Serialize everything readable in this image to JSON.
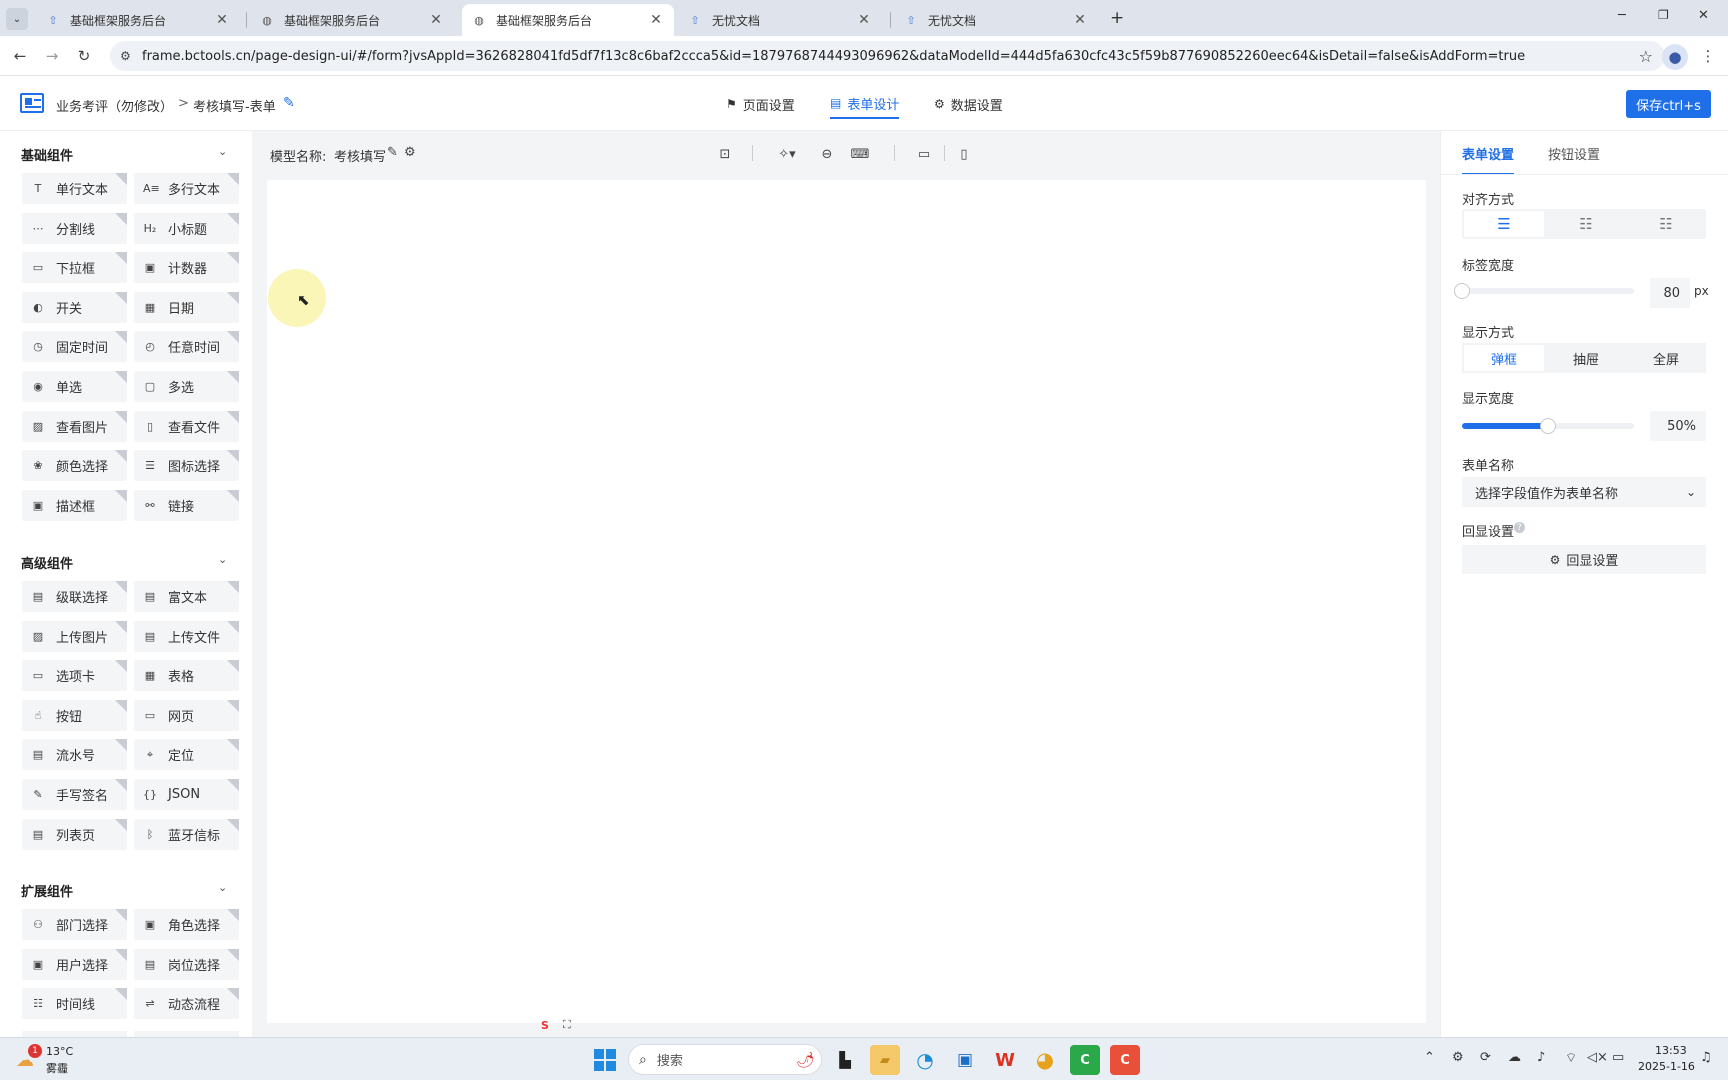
{
  "browser": {
    "tabs": [
      {
        "title": "基础框架服务后台",
        "active": false
      },
      {
        "title": "基础框架服务后台",
        "active": false
      },
      {
        "title": "基础框架服务后台",
        "active": true
      },
      {
        "title": "无忧文档",
        "active": false
      },
      {
        "title": "无忧文档",
        "active": false
      }
    ],
    "url": "frame.bctools.cn/page-design-ui/#/form?jvsAppId=3626828041fd5df7f13c8c6baf2ccca5&id=1879768744493096962&dataModelId=444d5fa630cfc43c5f59b877690852260eec64&isDetail=false&isAddForm=true"
  },
  "header": {
    "crumb_root": "业务考评（勿修改）",
    "crumb_sep": ">",
    "crumb_current": "考核填写-表单",
    "nav_tabs": [
      {
        "label": "页面设置",
        "icon": "bookmark-icon"
      },
      {
        "label": "表单设计",
        "icon": "form-icon"
      },
      {
        "label": "数据设置",
        "icon": "gear-icon"
      }
    ],
    "save_label": "保存ctrl+s"
  },
  "left": {
    "basic_title": "基础组件",
    "basic": [
      {
        "label": "单行文本",
        "icon": "T"
      },
      {
        "label": "多行文本",
        "icon": "A≡"
      },
      {
        "label": "分割线",
        "icon": "⋯"
      },
      {
        "label": "小标题",
        "icon": "H₂"
      },
      {
        "label": "下拉框",
        "icon": "▭"
      },
      {
        "label": "计数器",
        "icon": "▣"
      },
      {
        "label": "开关",
        "icon": "◐"
      },
      {
        "label": "日期",
        "icon": "▦"
      },
      {
        "label": "固定时间",
        "icon": "◷"
      },
      {
        "label": "任意时间",
        "icon": "◴"
      },
      {
        "label": "单选",
        "icon": "◉"
      },
      {
        "label": "多选",
        "icon": "▢"
      },
      {
        "label": "查看图片",
        "icon": "▨"
      },
      {
        "label": "查看文件",
        "icon": "▯"
      },
      {
        "label": "颜色选择",
        "icon": "❀"
      },
      {
        "label": "图标选择",
        "icon": "☰"
      },
      {
        "label": "描述框",
        "icon": "▣"
      },
      {
        "label": "链接",
        "icon": "⚯"
      }
    ],
    "advanced_title": "高级组件",
    "advanced": [
      {
        "label": "级联选择",
        "icon": "▤"
      },
      {
        "label": "富文本",
        "icon": "▤"
      },
      {
        "label": "上传图片",
        "icon": "▨"
      },
      {
        "label": "上传文件",
        "icon": "▤"
      },
      {
        "label": "选项卡",
        "icon": "▭"
      },
      {
        "label": "表格",
        "icon": "▦"
      },
      {
        "label": "按钮",
        "icon": "☝"
      },
      {
        "label": "网页",
        "icon": "▭"
      },
      {
        "label": "流水号",
        "icon": "▤"
      },
      {
        "label": "定位",
        "icon": "⌖"
      },
      {
        "label": "手写签名",
        "icon": "✎"
      },
      {
        "label": "JSON",
        "icon": "{}"
      },
      {
        "label": "列表页",
        "icon": "▤"
      },
      {
        "label": "蓝牙信标",
        "icon": "ᛒ"
      }
    ],
    "ext_title": "扩展组件",
    "ext": [
      {
        "label": "部门选择",
        "icon": "⚇"
      },
      {
        "label": "角色选择",
        "icon": "▣"
      },
      {
        "label": "用户选择",
        "icon": "▣"
      },
      {
        "label": "岗位选择",
        "icon": "▤"
      },
      {
        "label": "时间线",
        "icon": "☷"
      },
      {
        "label": "动态流程",
        "icon": "⇌"
      }
    ]
  },
  "canvas": {
    "model_label": "模型名称:",
    "model_name": "考核填写"
  },
  "right": {
    "tab_form": "表单设置",
    "tab_button": "按钮设置",
    "align_label": "对齐方式",
    "label_width_label": "标签宽度",
    "label_width_value": "80",
    "label_width_unit": "px",
    "label_width_fraction": 0.0,
    "display_mode_label": "显示方式",
    "display_modes": [
      "弹框",
      "抽屉",
      "全屏"
    ],
    "display_mode_selected": 0,
    "display_width_label": "显示宽度",
    "display_width_value": "50%",
    "display_width_fraction": 0.5,
    "form_name_label": "表单名称",
    "form_name_placeholder": "选择字段值作为表单名称",
    "echo_label": "回显设置",
    "echo_button": "回显设置"
  },
  "taskbar": {
    "weather_temp": "13°C",
    "weather_desc": "雾霾",
    "weather_badge": "1",
    "search": "搜索",
    "time": "13:53",
    "date": "2025-1-16"
  },
  "colors": {
    "accent": "#1e6fe8",
    "panel_bg": "#f4f5f7"
  }
}
